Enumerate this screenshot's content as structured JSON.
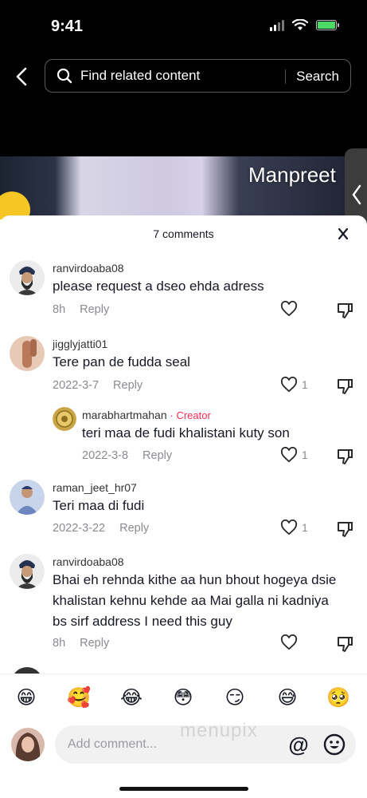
{
  "status": {
    "time": "9:41"
  },
  "search": {
    "placeholder": "Find related content",
    "button": "Search"
  },
  "video": {
    "overlay_text": "Manpreet"
  },
  "sheet": {
    "title": "7 comments"
  },
  "comments": [
    {
      "username": "ranvirdoaba08",
      "text": "please request a dseo ehda adress",
      "time": "8h",
      "reply": "Reply",
      "likes": ""
    },
    {
      "username": "jigglyjatti01",
      "text": "Tere pan de fudda seal",
      "time": "2022-3-7",
      "reply": "Reply",
      "likes": "1",
      "reply_item": {
        "username": "marabhartmahan",
        "badge": "· Creator",
        "text": "teri maa de fudi khalistani kuty son",
        "time": "2022-3-8",
        "reply": "Reply",
        "likes": "1"
      }
    },
    {
      "username": "raman_jeet_hr07",
      "text": "Teri maa di fudi",
      "time": "2022-3-22",
      "reply": "Reply",
      "likes": "1"
    },
    {
      "username": "ranvirdoaba08",
      "text": "Bhai eh rehnda kithe aa hun bhout hogeya dsie khalistan kehnu kehde aa Mai galla ni kadniya bs sirf address I need this guy",
      "time": "8h",
      "reply": "Reply",
      "likes": ""
    }
  ],
  "emojis": [
    "😁",
    "🥰",
    "😂",
    "😳",
    "😏",
    "😅",
    "🥺"
  ],
  "composer": {
    "placeholder": "Add comment...",
    "at_symbol": "@"
  },
  "watermark": "menupix",
  "colors": {
    "creator": "#fe2c55",
    "meta": "#8a8b91",
    "input_bg": "#f1f1f2"
  }
}
